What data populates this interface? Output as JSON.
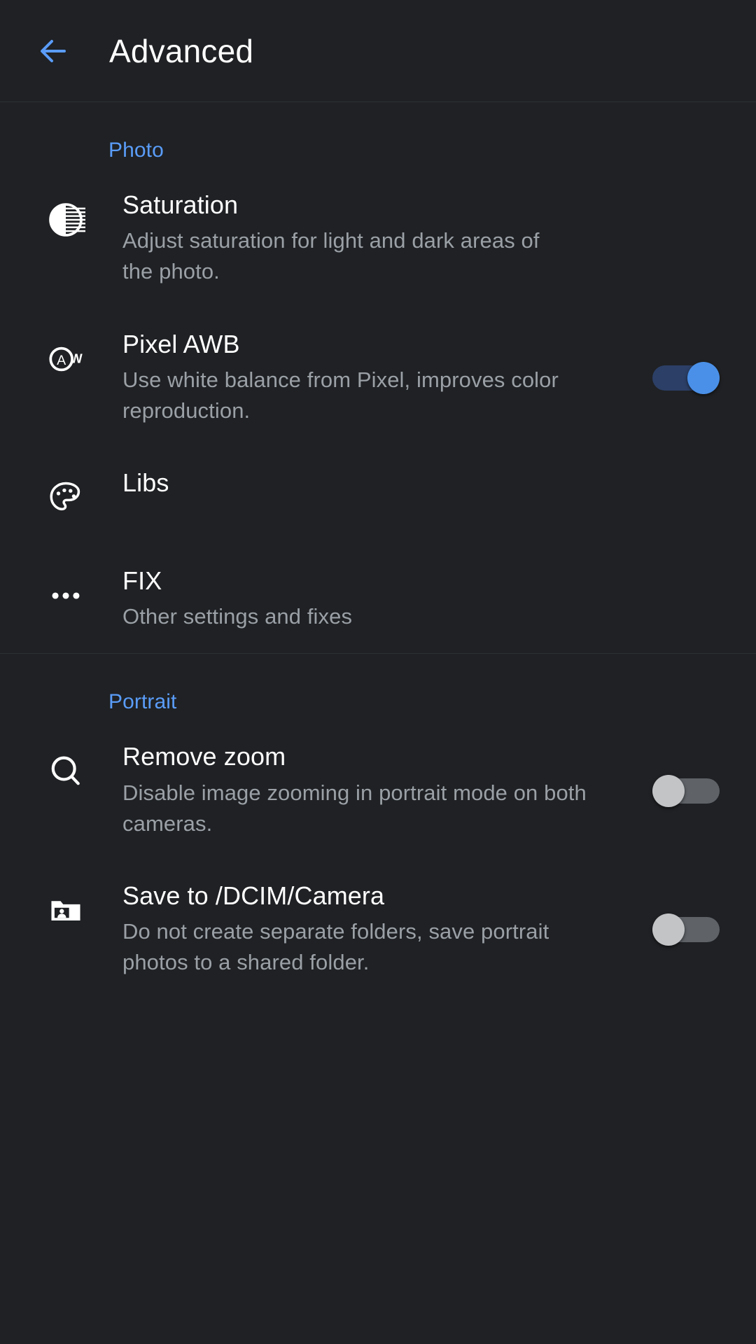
{
  "header": {
    "title": "Advanced",
    "back_icon": "arrow-left-icon",
    "accent_color": "#5a9cf8"
  },
  "colors": {
    "background": "#1f2124",
    "accent": "#5a9cf8",
    "title_text": "#ffffff",
    "desc_text": "#9aa0a6",
    "divider": "#2e3134",
    "switch_on_track": "#2c3f66",
    "switch_on_thumb": "#4a90e8",
    "switch_off_track": "#5f6368",
    "switch_off_thumb": "#c2c4c6"
  },
  "sections": [
    {
      "label": "Photo",
      "items": [
        {
          "icon": "tonality-icon",
          "title": "Saturation",
          "desc": "Adjust saturation for light and dark areas of the photo.",
          "control": "none"
        },
        {
          "icon": "auto-white-balance-icon",
          "title": "Pixel AWB",
          "desc": "Use white balance from Pixel, improves color reproduction.",
          "control": "switch",
          "switch_state": "on"
        },
        {
          "icon": "palette-icon",
          "title": "Libs",
          "desc": "",
          "control": "none"
        },
        {
          "icon": "more-horizontal-icon",
          "title": "FIX",
          "desc": "Other settings and fixes",
          "control": "none"
        }
      ]
    },
    {
      "label": "Portrait",
      "items": [
        {
          "icon": "search-icon",
          "title": "Remove zoom",
          "desc": "Disable image zooming in portrait mode on both cameras.",
          "control": "switch",
          "switch_state": "off"
        },
        {
          "icon": "folder-person-icon",
          "title": "Save to /DCIM/Camera",
          "desc": "Do not create separate folders, save portrait photos to a shared folder.",
          "control": "switch",
          "switch_state": "off"
        }
      ]
    }
  ]
}
